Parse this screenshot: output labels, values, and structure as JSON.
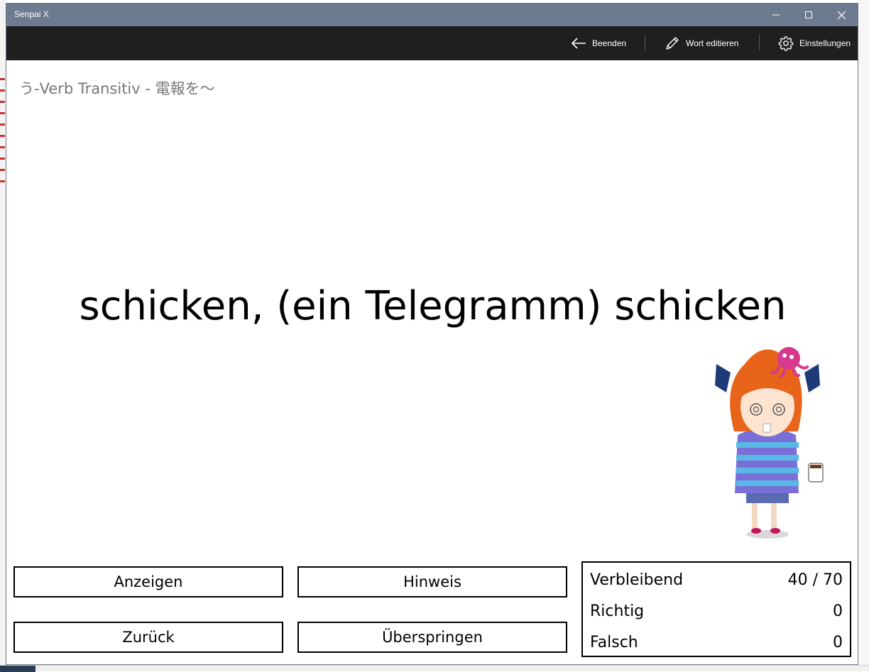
{
  "window": {
    "title": "Senpai X"
  },
  "commandbar": {
    "back_label": "Beenden",
    "edit_label": "Wort editieren",
    "settings_label": "Einstellungen"
  },
  "card": {
    "category": "う-Verb Transitiv - 電報を〜",
    "prompt": "schicken, (ein Telegramm) schicken"
  },
  "buttons": {
    "show": "Anzeigen",
    "hint": "Hinweis",
    "back": "Zurück",
    "skip": "Überspringen"
  },
  "stats": {
    "remaining_label": "Verbleibend",
    "remaining_value": "40 / 70",
    "correct_label": "Richtig",
    "correct_value": "0",
    "wrong_label": "Falsch",
    "wrong_value": "0"
  },
  "icons": {
    "back": "arrow-left-icon",
    "edit": "pencil-icon",
    "settings": "gear-icon",
    "minimize": "minimize-icon",
    "maximize": "maximize-icon",
    "close": "close-icon"
  },
  "colors": {
    "titlebar": "#6c7b8f",
    "commandbar": "#1f1f1f",
    "category_text": "#777777"
  }
}
